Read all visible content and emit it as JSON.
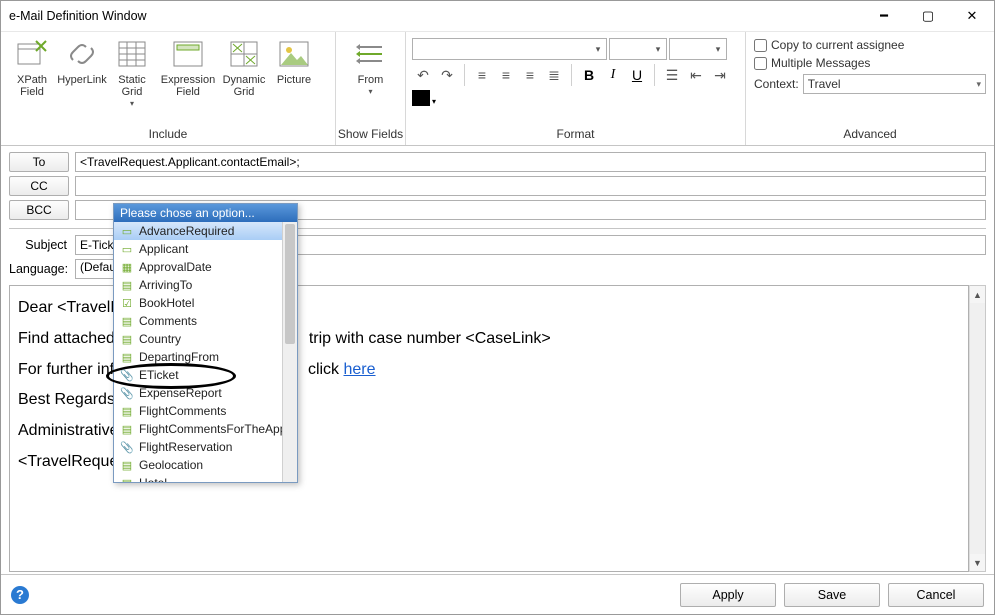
{
  "window": {
    "title": "e-Mail Definition Window"
  },
  "ribbon": {
    "include": {
      "label": "Include",
      "xpath_field": "XPath\nField",
      "hyperlink": "HyperLink",
      "static_grid": "Static\nGrid",
      "expression_field": "Expression\nField",
      "dynamic_grid": "Dynamic\nGrid",
      "picture": "Picture"
    },
    "show_fields": {
      "label": "Show Fields",
      "from": "From"
    },
    "format": {
      "label": "Format",
      "font_family": "",
      "font_size": "",
      "bold": "B",
      "italic": "I",
      "underline": "U"
    },
    "advanced": {
      "label": "Advanced",
      "copy_assignee": "Copy to current assignee",
      "multiple_messages": "Multiple Messages",
      "context_label": "Context:",
      "context_value": "Travel"
    }
  },
  "recipients": {
    "to_label": "To",
    "cc_label": "CC",
    "bcc_label": "BCC",
    "to_value": "<TravelRequest.Applicant.contactEmail>;",
    "cc_value": "",
    "bcc_value": ""
  },
  "subject": {
    "label": "Subject",
    "value": "E-Tick"
  },
  "language": {
    "label": "Language:",
    "value": "(Defau"
  },
  "body": {
    "line1_pre": "Dear <TravelRe",
    "line2_pre": "Find attached t",
    "line2_post": "trip with case number <CaseLink>",
    "line3_pre": "For further info",
    "line3_mid": "click ",
    "line3_link": "here",
    "line4": "Best Regards",
    "line5": "Administrative I",
    "line6": "<TravelRequest."
  },
  "popup": {
    "header": "Please chose an option...",
    "items": [
      {
        "icon": "form",
        "label": "AdvanceRequired",
        "selected": true
      },
      {
        "icon": "form",
        "label": "Applicant"
      },
      {
        "icon": "date",
        "label": "ApprovalDate"
      },
      {
        "icon": "text",
        "label": "ArrivingTo"
      },
      {
        "icon": "bool",
        "label": "BookHotel"
      },
      {
        "icon": "text",
        "label": "Comments"
      },
      {
        "icon": "text",
        "label": "Country"
      },
      {
        "icon": "text",
        "label": "DepartingFrom"
      },
      {
        "icon": "clip",
        "label": "ETicket"
      },
      {
        "icon": "clip",
        "label": "ExpenseReport"
      },
      {
        "icon": "text",
        "label": "FlightComments"
      },
      {
        "icon": "text",
        "label": "FlightCommentsForTheAppl"
      },
      {
        "icon": "clip",
        "label": "FlightReservation"
      },
      {
        "icon": "text",
        "label": "Geolocation"
      },
      {
        "icon": "text",
        "label": "Hotel"
      }
    ]
  },
  "footer": {
    "apply": "Apply",
    "save": "Save",
    "cancel": "Cancel"
  }
}
